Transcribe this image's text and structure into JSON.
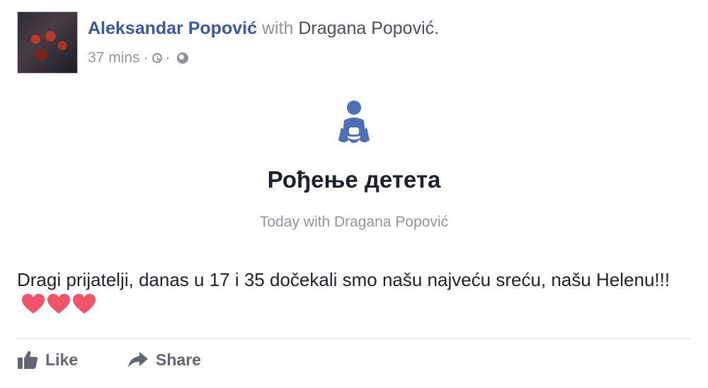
{
  "post": {
    "author": "Aleksandar Popović",
    "with_word": "with",
    "tagged": "Dragana Popović.",
    "time": "37 mins",
    "meta_separator": "·",
    "avatar_icon": "profile-photo",
    "clock_icon": "clock-icon",
    "globe_icon": "globe-icon"
  },
  "life_event": {
    "icon": "baby-icon",
    "title": "Рођење детета",
    "subtitle": "Today with Dragana Popović"
  },
  "message": {
    "text": "Dragi prijatelji, danas u 17 i 35 dočekali smo našu najveću sreću, našu Helenu!!!",
    "hearts_count": 3,
    "heart_color": "#f0546b"
  },
  "actions": {
    "like_label": "Like",
    "share_label": "Share",
    "like_icon": "thumbs-up-icon",
    "share_icon": "share-arrow-icon"
  },
  "colors": {
    "author": "#3b5998",
    "muted": "#90949c",
    "event_icon": "#4e6fb5"
  }
}
